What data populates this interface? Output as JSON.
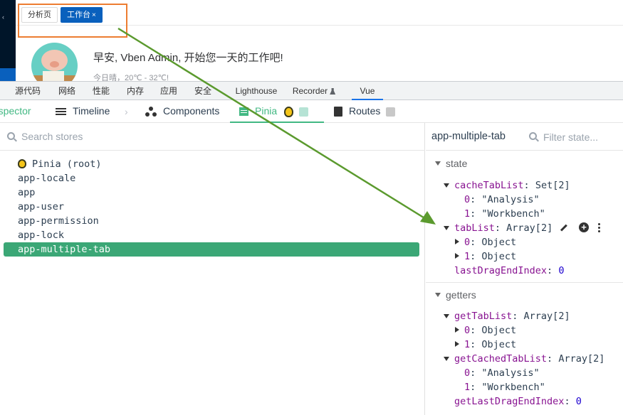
{
  "app": {
    "tabs": [
      {
        "label": "分析页",
        "active": false
      },
      {
        "label": "工作台",
        "active": true,
        "close": "×"
      }
    ],
    "greeting": "早安, Vben Admin, 开始您一天的工作吧!",
    "weather": "今日晴，20℃ - 32℃!",
    "sidebar_arrow": "‹"
  },
  "devtools": {
    "tabs": [
      "源代码",
      "网络",
      "性能",
      "内存",
      "应用",
      "安全",
      "Lighthouse",
      "Recorder",
      "Vue"
    ],
    "active_tab": "Vue"
  },
  "vue_toolbar": {
    "inspector": "Inspector",
    "timeline": "Timeline",
    "components": "Components",
    "pinia": "Pinia",
    "routes": "Routes",
    "separator": "›"
  },
  "stores": {
    "search_placeholder": "Search stores",
    "items": [
      {
        "label": "Pinia (root)",
        "selected": false
      },
      {
        "label": "app-locale",
        "selected": false
      },
      {
        "label": "app",
        "selected": false
      },
      {
        "label": "app-user",
        "selected": false
      },
      {
        "label": "app-permission",
        "selected": false
      },
      {
        "label": "app-lock",
        "selected": false
      },
      {
        "label": "app-multiple-tab",
        "selected": true
      }
    ]
  },
  "state_panel": {
    "title": "app-multiple-tab",
    "filter_placeholder": "Filter state...",
    "state_label": "state",
    "getters_label": "getters",
    "state": {
      "cacheTabList": {
        "key": "cacheTabList",
        "type": "Set[2]",
        "items": [
          {
            "i": "0",
            "v": "\"Analysis\""
          },
          {
            "i": "1",
            "v": "\"Workbench\""
          }
        ]
      },
      "tabList": {
        "key": "tabList",
        "type": "Array[2]",
        "items": [
          {
            "i": "0",
            "v": "Object"
          },
          {
            "i": "1",
            "v": "Object"
          }
        ]
      },
      "lastDragEndIndex": {
        "key": "lastDragEndIndex",
        "value": "0"
      }
    },
    "getters": {
      "getTabList": {
        "key": "getTabList",
        "type": "Array[2]",
        "items": [
          {
            "i": "0",
            "v": "Object"
          },
          {
            "i": "1",
            "v": "Object"
          }
        ]
      },
      "getCachedTabList": {
        "key": "getCachedTabList",
        "type": "Array[2]",
        "items": [
          {
            "i": "0",
            "v": "\"Analysis\""
          },
          {
            "i": "1",
            "v": "\"Workbench\""
          }
        ]
      },
      "getLastDragEndIndex": {
        "key": "getLastDragEndIndex",
        "value": "0"
      }
    }
  },
  "colors": {
    "vue_green": "#42b883",
    "selected_row": "#3ba776",
    "app_primary": "#0960bd",
    "highlight_box": "#ed7d31",
    "annotation_arrow": "#5b9a2e"
  },
  "icons": [
    "timeline-icon",
    "components-icon",
    "pinia-icon",
    "puzzle-icon",
    "routes-icon",
    "search-icon",
    "edit-icon",
    "add-icon",
    "more-icon"
  ]
}
